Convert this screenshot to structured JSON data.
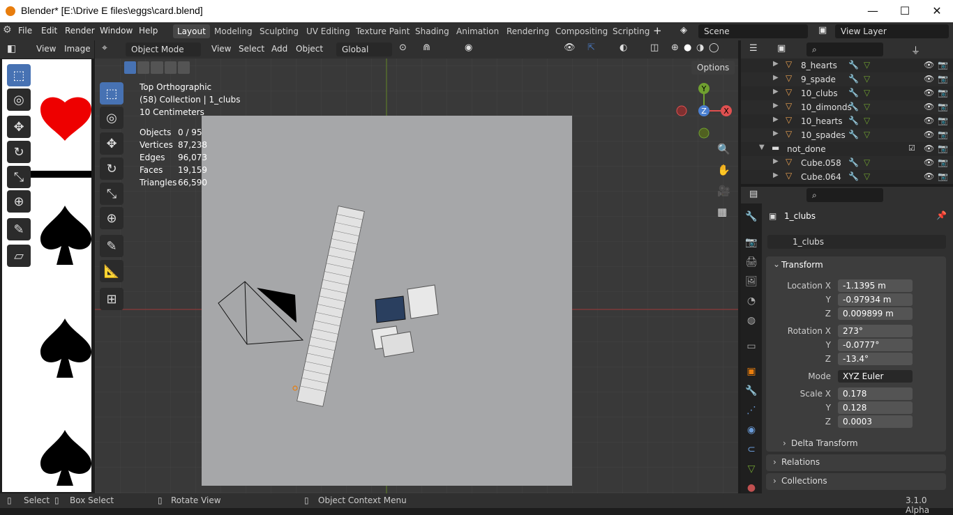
{
  "window": {
    "title": "Blender* [E:\\Drive E files\\eggs\\card.blend]",
    "min": "—",
    "max": "☐",
    "close": "✕"
  },
  "menus": [
    "File",
    "Edit",
    "Render",
    "Window",
    "Help"
  ],
  "workspaces": [
    "Layout",
    "Modeling",
    "Sculpting",
    "UV Editing",
    "Texture Paint",
    "Shading",
    "Animation",
    "Rendering",
    "Compositing",
    "Scripting"
  ],
  "scene": {
    "label": "Scene",
    "view_layer": "View Layer"
  },
  "image_editor": {
    "menus": [
      "View",
      "Image"
    ]
  },
  "viewport": {
    "mode": "Object Mode",
    "menus": [
      "View",
      "Select",
      "Add",
      "Object"
    ],
    "orientation": "Global",
    "options": "Options",
    "view_name": "Top Orthographic",
    "collection": "(58) Collection | 1_clubs",
    "scale": "10 Centimeters",
    "stats": [
      {
        "label": "Objects",
        "value": "0 / 95"
      },
      {
        "label": "Vertices",
        "value": "87,238"
      },
      {
        "label": "Edges",
        "value": "96,073"
      },
      {
        "label": "Faces",
        "value": "19,159"
      },
      {
        "label": "Triangles",
        "value": "66,590"
      }
    ],
    "gizmo": {
      "x": "X",
      "y": "Y",
      "z": "Z"
    }
  },
  "outliner": {
    "rows": [
      {
        "name": "8_hearts",
        "type": "obj"
      },
      {
        "name": "9_spade",
        "type": "obj"
      },
      {
        "name": "10_clubs",
        "type": "obj"
      },
      {
        "name": "10_dimonds",
        "type": "obj"
      },
      {
        "name": "10_hearts",
        "type": "obj"
      },
      {
        "name": "10_spades",
        "type": "obj"
      },
      {
        "name": "not_done",
        "type": "coll"
      },
      {
        "name": "Cube.058",
        "type": "obj"
      },
      {
        "name": "Cube.064",
        "type": "obj"
      }
    ]
  },
  "properties": {
    "object_name": "1_clubs",
    "datablock": "1_clubs",
    "transform_label": "Transform",
    "location": {
      "label": "Location X",
      "x": "-1.1395 m",
      "y": "-0.97934 m",
      "z": "0.009899 m"
    },
    "rotation": {
      "label": "Rotation X",
      "x": "273°",
      "y": "-0.0777°",
      "z": "-13.4°"
    },
    "mode_label": "Mode",
    "mode": "XYZ Euler",
    "scale": {
      "label": "Scale X",
      "x": "0.178",
      "y": "0.128",
      "z": "0.0003"
    },
    "y_label": "Y",
    "z_label": "Z",
    "delta": "Delta Transform",
    "relations": "Relations",
    "collections": "Collections"
  },
  "status": {
    "select": "Select",
    "box_select": "Box Select",
    "rotate": "Rotate View",
    "context": "Object Context Menu",
    "version": "3.1.0 Alpha"
  }
}
